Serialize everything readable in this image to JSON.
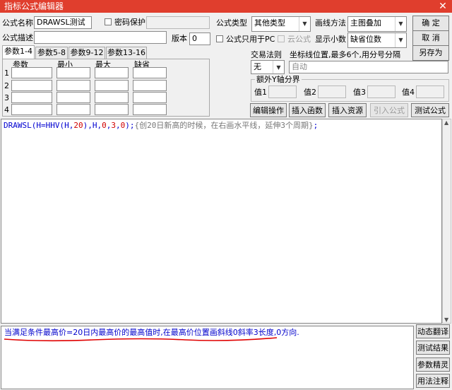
{
  "window": {
    "title": "指标公式编辑器",
    "close_glyph": "✕"
  },
  "form": {
    "name_label": "公式名称",
    "name_value": "DRAWSL测试",
    "password_label": "密码保护",
    "desc_label": "公式描述",
    "desc_value": "",
    "version_label": "版本",
    "version_value": "0",
    "type_label": "公式类型",
    "type_value": "其他类型",
    "draw_label": "画线方法",
    "draw_value": "主图叠加",
    "pc_only_label": "公式只用于PC",
    "cloud_label": "云公式",
    "decimal_label": "显示小数",
    "decimal_value": "缺省位数"
  },
  "buttons": {
    "ok": "确  定",
    "cancel": "取  消",
    "save_as": "另存为",
    "edit_ops": "编辑操作",
    "insert_func": "插入函数",
    "insert_res": "插入资源",
    "import_formula": "引入公式",
    "test_formula": "测试公式",
    "dyn_translate": "动态翻译",
    "test_result": "测试结果",
    "param_wizard": "参数精灵",
    "usage_notes": "用法注释"
  },
  "param_tabs": [
    "参数1-4",
    "参数5-8",
    "参数9-12",
    "参数13-16"
  ],
  "param_headers": [
    "参数",
    "最小",
    "最大",
    "缺省"
  ],
  "param_rows": [
    "1",
    "2",
    "3",
    "4"
  ],
  "trade": {
    "rule_label": "交易法则",
    "rule_value": "无",
    "axis_label": "坐标线位置,最多6个,用分号分隔",
    "axis_value": "自动"
  },
  "extra_y": {
    "title": "额外Y轴分界",
    "labels": [
      "值1",
      "值2",
      "值3",
      "值4"
    ]
  },
  "editor": {
    "func": "DRAWSL",
    "p1": "(H=HHV(H,",
    "n20": "20",
    "p2": "),H,",
    "n0a": "0",
    "comma1": ",",
    "n3": "3",
    "comma2": ",",
    "n0b": "0",
    "p3": ");",
    "comment": "{创20日新高的时候，在右画水平线，延伸3个周期}",
    "tail": ";"
  },
  "description": "当满足条件最高价=20日内最高价的最高值时,在最高价位置画斜线0斜率3长度,0方向."
}
